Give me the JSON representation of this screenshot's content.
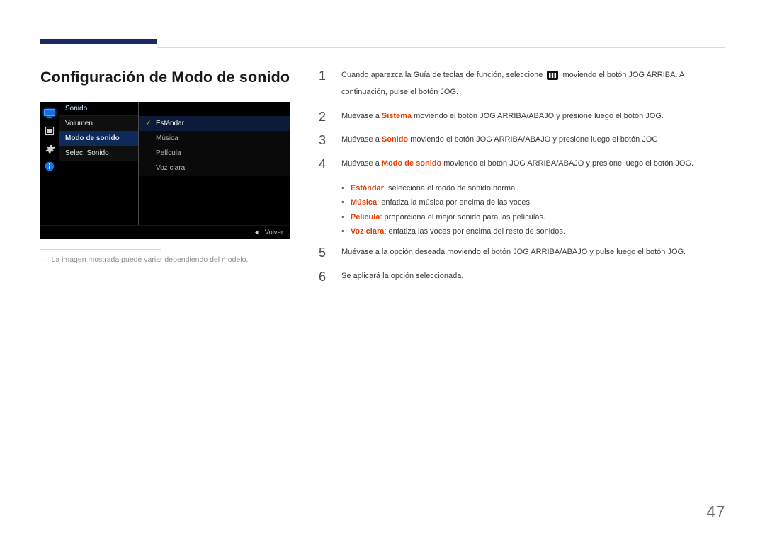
{
  "page_number": "47",
  "title": "Configuración de Modo de sonido",
  "caption": {
    "prefix": "―",
    "text": "La imagen mostrada puede variar dependiendo del modelo."
  },
  "osd": {
    "section_header": "Sonido",
    "menu_items": [
      "Volumen",
      "Modo de sonido",
      "Selec. Sonido"
    ],
    "menu_selected_index": 1,
    "options": [
      "Estándar",
      "Música",
      "Película",
      "Voz clara"
    ],
    "option_selected_index": 0,
    "footer_back": "Volver"
  },
  "steps": [
    {
      "n": "1",
      "pre": "Cuando aparezca la Guía de teclas de función, seleccione ",
      "post": " moviendo el botón JOG ARRIBA. A continuación, pulse el botón JOG."
    },
    {
      "n": "2",
      "pre": "Muévase a ",
      "bold": "Sistema",
      "post": " moviendo el botón JOG ARRIBA/ABAJO y presione luego el botón JOG."
    },
    {
      "n": "3",
      "pre": "Muévase a ",
      "bold": "Sonido",
      "post": " moviendo el botón JOG ARRIBA/ABAJO y presione luego el botón JOG."
    },
    {
      "n": "4",
      "pre": "Muévase a ",
      "bold": "Modo de sonido",
      "post": " moviendo el botón JOG ARRIBA/ABAJO y presione luego el botón JOG."
    },
    {
      "n": "5",
      "text": "Muévase a la opción deseada moviendo el botón JOG ARRIBA/ABAJO y pulse luego el botón JOG."
    },
    {
      "n": "6",
      "text": "Se aplicará la opción seleccionada."
    }
  ],
  "bullets": [
    {
      "bold": "Estándar",
      "rest": ": selecciona el modo de sonido normal."
    },
    {
      "bold": "Música",
      "rest": ": enfatiza la música por encima de las voces."
    },
    {
      "bold": "Película",
      "rest": ": proporciona el mejor sonido para las películas."
    },
    {
      "bold": "Voz clara",
      "rest": ": enfatiza las voces por encima del resto de sonidos."
    }
  ]
}
